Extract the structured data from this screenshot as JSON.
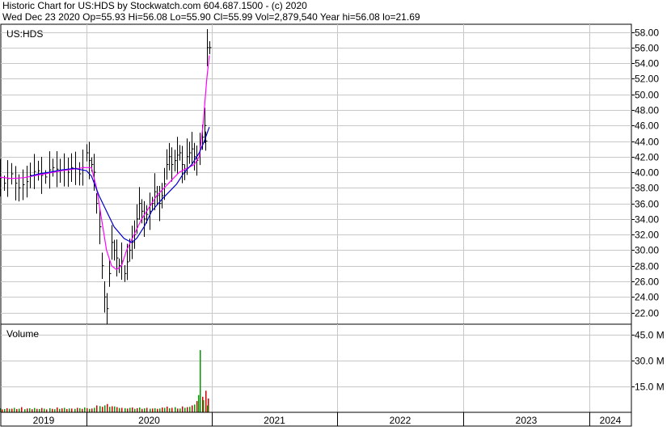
{
  "header": {
    "line1": "Historic Chart for US:HDS by Stockwatch.com 604.687.1500 - (c) 2020",
    "line2": "Wed Dec 23 2020   Op=55.93  Hi=56.08  Lo=55.90  Cl=55.99  Vol=2,879,540  Year hi=56.08  lo=21.69"
  },
  "chart_data": [
    {
      "type": "line",
      "title": "US:HDS",
      "ylim": [
        20.5,
        59
      ],
      "y_ticks": [
        "58.00",
        "56.00",
        "54.00",
        "52.00",
        "50.00",
        "48.00",
        "46.00",
        "44.00",
        "42.00",
        "40.00",
        "38.00",
        "36.00",
        "34.00",
        "32.00",
        "30.00",
        "28.00",
        "26.00",
        "24.00",
        "22.00"
      ],
      "x_labels": [
        "2019",
        "2020",
        "2021",
        "2022",
        "2023",
        "2024"
      ],
      "series": [
        {
          "color": "#000000",
          "style": "price-bars",
          "points": [
            [
              0.0,
              46.5
            ],
            [
              0.02,
              45.0
            ],
            [
              0.04,
              44.0
            ],
            [
              0.06,
              43.6
            ],
            [
              0.08,
              43.0
            ],
            [
              0.1,
              42.2
            ],
            [
              0.13,
              42.5
            ],
            [
              0.16,
              41.0
            ],
            [
              0.19,
              40.5
            ],
            [
              0.22,
              40.0
            ],
            [
              0.25,
              40.6
            ],
            [
              0.28,
              40.0
            ],
            [
              0.31,
              39.3
            ],
            [
              0.34,
              38.6
            ],
            [
              0.37,
              39.2
            ],
            [
              0.4,
              39.8
            ],
            [
              0.43,
              38.6
            ],
            [
              0.46,
              38.0
            ],
            [
              0.49,
              38.4
            ],
            [
              0.52,
              38.8
            ],
            [
              0.55,
              39.6
            ],
            [
              0.58,
              40.1
            ],
            [
              0.61,
              40.2
            ],
            [
              0.64,
              39.6
            ],
            [
              0.67,
              39.4
            ],
            [
              0.7,
              40.3
            ],
            [
              0.73,
              40.6
            ],
            [
              0.76,
              40.4
            ],
            [
              0.79,
              40.2
            ],
            [
              0.82,
              40.3
            ],
            [
              0.85,
              40.0
            ],
            [
              0.88,
              40.6
            ],
            [
              0.91,
              40.5
            ],
            [
              0.94,
              39.8
            ],
            [
              0.97,
              40.6
            ],
            [
              1.0,
              42.5
            ],
            [
              1.02,
              41.5
            ],
            [
              1.04,
              41.0
            ],
            [
              1.06,
              40.0
            ],
            [
              1.08,
              36.0
            ],
            [
              1.1,
              33.0
            ],
            [
              1.12,
              28.0
            ],
            [
              1.14,
              24.0
            ],
            [
              1.16,
              22.5
            ],
            [
              1.18,
              27.0
            ],
            [
              1.2,
              31.0
            ],
            [
              1.22,
              30.0
            ],
            [
              1.24,
              29.0
            ],
            [
              1.26,
              28.0
            ],
            [
              1.28,
              28.6
            ],
            [
              1.3,
              27.0
            ],
            [
              1.32,
              28.5
            ],
            [
              1.34,
              30.0
            ],
            [
              1.36,
              31.0
            ],
            [
              1.38,
              32.0
            ],
            [
              1.4,
              34.0
            ],
            [
              1.42,
              36.0
            ],
            [
              1.44,
              35.0
            ],
            [
              1.46,
              34.0
            ],
            [
              1.48,
              34.6
            ],
            [
              1.5,
              35.0
            ],
            [
              1.52,
              36.0
            ],
            [
              1.54,
              37.5
            ],
            [
              1.56,
              37.0
            ],
            [
              1.58,
              36.0
            ],
            [
              1.6,
              37.0
            ],
            [
              1.62,
              38.5
            ],
            [
              1.64,
              41.0
            ],
            [
              1.66,
              42.0
            ],
            [
              1.68,
              41.0
            ],
            [
              1.7,
              41.5
            ],
            [
              1.72,
              42.2
            ],
            [
              1.74,
              42.5
            ],
            [
              1.76,
              41.0
            ],
            [
              1.78,
              40.0
            ],
            [
              1.8,
              42.0
            ],
            [
              1.82,
              42.5
            ],
            [
              1.84,
              43.0
            ],
            [
              1.86,
              42.0
            ],
            [
              1.88,
              41.5
            ],
            [
              1.9,
              43.0
            ],
            [
              1.92,
              44.5
            ],
            [
              1.94,
              46.0
            ],
            [
              1.95,
              44.0
            ],
            [
              1.96,
              56.0
            ],
            [
              1.98,
              56.0
            ]
          ]
        },
        {
          "color": "#ff00ff",
          "style": "moving-average",
          "points": [
            [
              0.02,
              43.0
            ],
            [
              0.08,
              42.0
            ],
            [
              0.14,
              41.0
            ],
            [
              0.22,
              40.0
            ],
            [
              0.3,
              39.4
            ],
            [
              0.4,
              39.2
            ],
            [
              0.5,
              39.3
            ],
            [
              0.6,
              39.6
            ],
            [
              0.7,
              39.9
            ],
            [
              0.8,
              40.2
            ],
            [
              0.9,
              40.4
            ],
            [
              0.98,
              40.6
            ],
            [
              1.04,
              40.6
            ],
            [
              1.08,
              38.0
            ],
            [
              1.12,
              34.0
            ],
            [
              1.16,
              30.0
            ],
            [
              1.2,
              28.0
            ],
            [
              1.24,
              27.5
            ],
            [
              1.28,
              28.0
            ],
            [
              1.32,
              30.0
            ],
            [
              1.38,
              32.0
            ],
            [
              1.44,
              34.0
            ],
            [
              1.5,
              35.5
            ],
            [
              1.56,
              37.0
            ],
            [
              1.62,
              38.0
            ],
            [
              1.68,
              39.0
            ],
            [
              1.74,
              40.0
            ],
            [
              1.8,
              40.5
            ],
            [
              1.86,
              41.0
            ],
            [
              1.9,
              42.0
            ],
            [
              1.93,
              46.0
            ],
            [
              1.96,
              52.0
            ],
            [
              1.98,
              55.0
            ]
          ]
        },
        {
          "color": "#0000cc",
          "style": "moving-average",
          "points": [
            [
              0.55,
              39.5
            ],
            [
              0.62,
              39.8
            ],
            [
              0.7,
              40.0
            ],
            [
              0.8,
              40.3
            ],
            [
              0.9,
              40.5
            ],
            [
              1.0,
              40.2
            ],
            [
              1.04,
              39.5
            ],
            [
              1.1,
              37.0
            ],
            [
              1.16,
              35.0
            ],
            [
              1.22,
              33.0
            ],
            [
              1.3,
              31.5
            ],
            [
              1.36,
              31.0
            ],
            [
              1.4,
              31.5
            ],
            [
              1.46,
              33.0
            ],
            [
              1.52,
              35.0
            ],
            [
              1.6,
              36.5
            ],
            [
              1.66,
              37.5
            ],
            [
              1.72,
              38.5
            ],
            [
              1.78,
              40.0
            ],
            [
              1.84,
              41.0
            ],
            [
              1.9,
              42.5
            ],
            [
              1.94,
              44.0
            ],
            [
              1.98,
              45.8
            ]
          ]
        }
      ]
    },
    {
      "type": "bar",
      "title": "Volume",
      "ylim": [
        0,
        51
      ],
      "y_ticks": [
        "45.0 M",
        "30.0 M",
        "15.0 M"
      ],
      "series": [
        {
          "color": "#cc0000",
          "values": [
            [
              0.0,
              2.2
            ],
            [
              0.04,
              3.5
            ],
            [
              0.08,
              2.5
            ],
            [
              0.12,
              3.1
            ],
            [
              0.16,
              2.0
            ],
            [
              0.2,
              1.8
            ],
            [
              0.24,
              2.6
            ],
            [
              0.28,
              2.0
            ],
            [
              0.32,
              1.7
            ],
            [
              0.36,
              2.4
            ],
            [
              0.4,
              2.1
            ],
            [
              0.44,
              1.9
            ],
            [
              0.48,
              3.0
            ],
            [
              0.52,
              2.2
            ],
            [
              0.56,
              1.8
            ],
            [
              0.6,
              2.0
            ],
            [
              0.64,
              2.5
            ],
            [
              0.68,
              1.7
            ],
            [
              0.72,
              2.0
            ],
            [
              0.76,
              2.8
            ],
            [
              0.8,
              2.3
            ],
            [
              0.84,
              1.9
            ],
            [
              0.88,
              2.2
            ],
            [
              0.92,
              2.6
            ],
            [
              0.96,
              2.0
            ],
            [
              1.0,
              2.4
            ],
            [
              1.04,
              2.2
            ],
            [
              1.08,
              4.0
            ],
            [
              1.12,
              3.2
            ],
            [
              1.16,
              4.8
            ],
            [
              1.2,
              3.5
            ],
            [
              1.24,
              3.0
            ],
            [
              1.28,
              2.6
            ],
            [
              1.32,
              2.2
            ],
            [
              1.36,
              2.8
            ],
            [
              1.4,
              2.4
            ],
            [
              1.44,
              2.0
            ],
            [
              1.48,
              2.6
            ],
            [
              1.52,
              2.2
            ],
            [
              1.56,
              2.0
            ],
            [
              1.6,
              2.8
            ],
            [
              1.64,
              3.3
            ],
            [
              1.68,
              2.6
            ],
            [
              1.72,
              2.2
            ],
            [
              1.76,
              3.4
            ],
            [
              1.8,
              3.0
            ],
            [
              1.84,
              4.0
            ],
            [
              1.88,
              6.5
            ],
            [
              1.92,
              9.0
            ],
            [
              1.95,
              12.5
            ],
            [
              1.97,
              8.0
            ]
          ]
        },
        {
          "color": "#009900",
          "values": [
            [
              0.02,
              2.8
            ],
            [
              0.06,
              2.0
            ],
            [
              0.1,
              2.4
            ],
            [
              0.14,
              3.0
            ],
            [
              0.18,
              2.0
            ],
            [
              0.22,
              1.6
            ],
            [
              0.26,
              2.2
            ],
            [
              0.3,
              2.4
            ],
            [
              0.34,
              1.9
            ],
            [
              0.38,
              2.0
            ],
            [
              0.42,
              2.6
            ],
            [
              0.46,
              2.1
            ],
            [
              0.5,
              1.8
            ],
            [
              0.54,
              2.3
            ],
            [
              0.58,
              2.5
            ],
            [
              0.62,
              1.9
            ],
            [
              0.66,
              2.1
            ],
            [
              0.7,
              2.4
            ],
            [
              0.74,
              1.8
            ],
            [
              0.78,
              2.0
            ],
            [
              0.82,
              2.6
            ],
            [
              0.86,
              2.2
            ],
            [
              0.9,
              2.0
            ],
            [
              0.94,
              2.4
            ],
            [
              0.98,
              2.8
            ],
            [
              1.02,
              2.0
            ],
            [
              1.06,
              2.6
            ],
            [
              1.1,
              3.6
            ],
            [
              1.14,
              4.0
            ],
            [
              1.18,
              3.2
            ],
            [
              1.22,
              3.4
            ],
            [
              1.26,
              2.5
            ],
            [
              1.3,
              2.4
            ],
            [
              1.34,
              2.6
            ],
            [
              1.38,
              2.0
            ],
            [
              1.42,
              2.8
            ],
            [
              1.46,
              2.3
            ],
            [
              1.5,
              2.1
            ],
            [
              1.54,
              2.4
            ],
            [
              1.58,
              2.2
            ],
            [
              1.62,
              2.6
            ],
            [
              1.66,
              2.4
            ],
            [
              1.7,
              3.0
            ],
            [
              1.74,
              2.2
            ],
            [
              1.78,
              2.6
            ],
            [
              1.82,
              3.2
            ],
            [
              1.86,
              4.5
            ],
            [
              1.89,
              10.0
            ],
            [
              1.9,
              36.0
            ],
            [
              1.93,
              7.0
            ],
            [
              1.96,
              4.0
            ]
          ]
        }
      ]
    }
  ]
}
